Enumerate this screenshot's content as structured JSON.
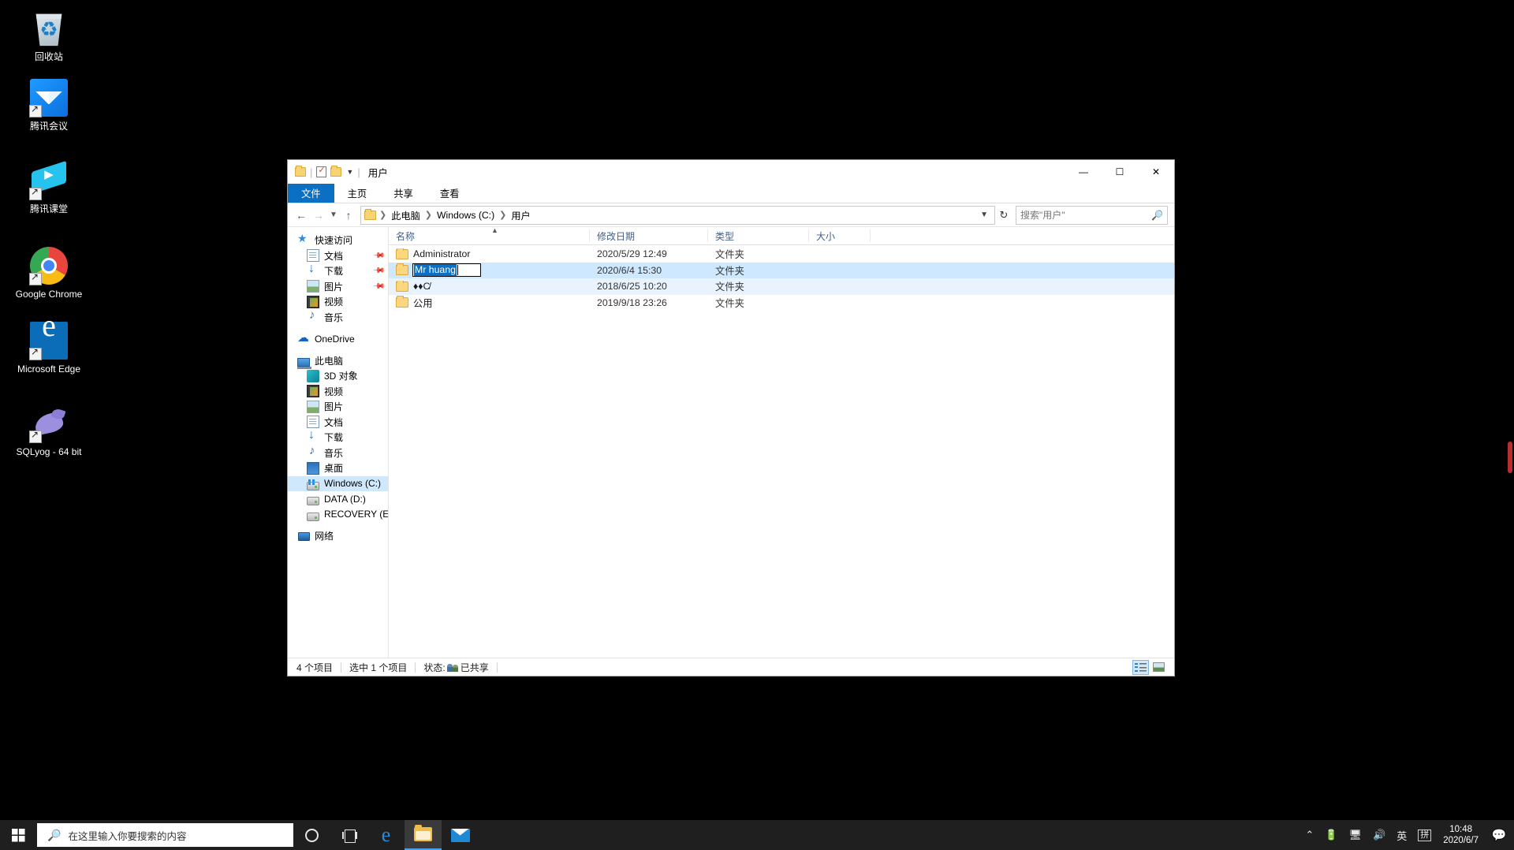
{
  "desktop": {
    "icons": [
      {
        "label": "回收站",
        "icon": "recycle-bin-icon",
        "shortcut": false
      },
      {
        "label": "腾讯会议",
        "icon": "tencent-meeting-icon",
        "shortcut": true
      },
      {
        "label": "腾讯课堂",
        "icon": "tencent-classroom-icon",
        "shortcut": true
      },
      {
        "label": "Google Chrome",
        "icon": "chrome-icon",
        "shortcut": true
      },
      {
        "label": "Microsoft Edge",
        "icon": "edge-icon",
        "shortcut": true
      },
      {
        "label": "SQLyog - 64 bit",
        "icon": "sqlyog-icon",
        "shortcut": true
      }
    ]
  },
  "explorer": {
    "title": "用户",
    "quick_access_toolbar": {
      "folder_icon": "folder-icon",
      "properties_icon": "properties-icon",
      "new_folder_icon": "new-folder-icon",
      "dropdown_icon": "chevron-down-icon"
    },
    "window_controls": {
      "minimize": "—",
      "maximize": "☐",
      "close": "✕"
    },
    "ribbon_tabs": [
      {
        "label": "文件",
        "active": true
      },
      {
        "label": "主页",
        "active": false
      },
      {
        "label": "共享",
        "active": false
      },
      {
        "label": "查看",
        "active": false
      }
    ],
    "ribbon_collapse_icon": "chevron-up-icon",
    "help_icon": "help-icon",
    "navigation": {
      "back_icon": "arrow-left-icon",
      "forward_icon": "arrow-right-icon",
      "recent_icon": "chevron-down-icon",
      "up_icon": "arrow-up-icon",
      "refresh_icon": "refresh-icon",
      "address_dropdown_icon": "chevron-down-icon"
    },
    "breadcrumbs": [
      "此电脑",
      "Windows (C:)",
      "用户"
    ],
    "search": {
      "placeholder": "搜索\"用户\"",
      "icon": "search-icon"
    },
    "nav_pane": {
      "items": [
        {
          "label": "快速访问",
          "icon": "star-icon",
          "indent": 0,
          "pinned": false,
          "selected": false
        },
        {
          "label": "文档",
          "icon": "documents-icon",
          "indent": 1,
          "pinned": true,
          "selected": false
        },
        {
          "label": "下载",
          "icon": "downloads-icon",
          "indent": 1,
          "pinned": true,
          "selected": false
        },
        {
          "label": "图片",
          "icon": "pictures-icon",
          "indent": 1,
          "pinned": true,
          "selected": false
        },
        {
          "label": "视频",
          "icon": "videos-icon",
          "indent": 1,
          "pinned": false,
          "selected": false
        },
        {
          "label": "音乐",
          "icon": "music-icon",
          "indent": 1,
          "pinned": false,
          "selected": false
        },
        {
          "label": "OneDrive",
          "icon": "onedrive-icon",
          "indent": 0,
          "pinned": false,
          "selected": false,
          "gap_before": true
        },
        {
          "label": "此电脑",
          "icon": "this-pc-icon",
          "indent": 0,
          "pinned": false,
          "selected": false,
          "gap_before": true
        },
        {
          "label": "3D 对象",
          "icon": "3d-objects-icon",
          "indent": 1,
          "pinned": false,
          "selected": false
        },
        {
          "label": "视频",
          "icon": "videos-icon",
          "indent": 1,
          "pinned": false,
          "selected": false
        },
        {
          "label": "图片",
          "icon": "pictures-icon",
          "indent": 1,
          "pinned": false,
          "selected": false
        },
        {
          "label": "文档",
          "icon": "documents-icon",
          "indent": 1,
          "pinned": false,
          "selected": false
        },
        {
          "label": "下载",
          "icon": "downloads-icon",
          "indent": 1,
          "pinned": false,
          "selected": false
        },
        {
          "label": "音乐",
          "icon": "music-icon",
          "indent": 1,
          "pinned": false,
          "selected": false
        },
        {
          "label": "桌面",
          "icon": "desktop-icon",
          "indent": 1,
          "pinned": false,
          "selected": false
        },
        {
          "label": "Windows (C:)",
          "icon": "windows-drive-icon",
          "indent": 1,
          "pinned": false,
          "selected": true
        },
        {
          "label": "DATA (D:)",
          "icon": "hdd-icon",
          "indent": 1,
          "pinned": false,
          "selected": false
        },
        {
          "label": "RECOVERY (E:)",
          "icon": "hdd-icon",
          "indent": 1,
          "pinned": false,
          "selected": false
        },
        {
          "label": "网络",
          "icon": "network-icon",
          "indent": 0,
          "pinned": false,
          "selected": false,
          "gap_before": true
        }
      ]
    },
    "columns": [
      {
        "key": "name",
        "label": "名称",
        "sorted": true,
        "sort_dir": "asc"
      },
      {
        "key": "date",
        "label": "修改日期",
        "sorted": false
      },
      {
        "key": "type",
        "label": "类型",
        "sorted": false
      },
      {
        "key": "size",
        "label": "大小",
        "sorted": false
      }
    ],
    "files": [
      {
        "name": "Administrator",
        "date": "2020/5/29 12:49",
        "type": "文件夹",
        "size": "",
        "state": "normal",
        "editing": false
      },
      {
        "name": "Mr huang",
        "date": "2020/6/4 15:30",
        "type": "文件夹",
        "size": "",
        "state": "selected",
        "editing": true
      },
      {
        "name": "♦♦C̸",
        "date": "2018/6/25 10:20",
        "type": "文件夹",
        "size": "",
        "state": "highlight",
        "editing": false
      },
      {
        "name": "公用",
        "date": "2019/9/18 23:26",
        "type": "文件夹",
        "size": "",
        "state": "normal",
        "editing": false
      }
    ],
    "status_bar": {
      "item_count": "4 个项目",
      "selected_count": "选中 1 个项目",
      "state_label": "状态:",
      "state_value": "已共享",
      "share_icon": "shared-users-icon",
      "view_buttons": [
        {
          "name": "details-view-button",
          "active": true
        },
        {
          "name": "large-icons-view-button",
          "active": false
        }
      ]
    }
  },
  "taskbar": {
    "start_icon": "windows-start-icon",
    "search": {
      "placeholder": "在这里输入你要搜索的内容",
      "icon": "search-icon"
    },
    "buttons": [
      {
        "name": "cortana-button",
        "icon": "cortana-icon",
        "active": false
      },
      {
        "name": "task-view-button",
        "icon": "task-view-icon",
        "active": false
      },
      {
        "name": "edge-taskbar-button",
        "icon": "edge-icon",
        "active": false
      },
      {
        "name": "file-explorer-taskbar-button",
        "icon": "folder-icon",
        "active": true
      },
      {
        "name": "mail-taskbar-button",
        "icon": "mail-icon",
        "active": false
      }
    ],
    "tray": [
      {
        "name": "show-hidden-icons",
        "glyph": "⌃"
      },
      {
        "name": "battery-icon",
        "glyph": "🔋"
      },
      {
        "name": "network-icon",
        "glyph": "🖥"
      },
      {
        "name": "volume-icon",
        "glyph": "🔊"
      },
      {
        "name": "ime-language-icon",
        "glyph": "英"
      },
      {
        "name": "ime-pinyin-icon",
        "glyph": "拼"
      }
    ],
    "clock": {
      "time": "10:48",
      "date": "2020/6/7"
    },
    "notification_icon": "action-center-icon"
  },
  "colors": {
    "accent": "#0b6fc4",
    "selection": "#cde8ff",
    "highlight": "#e8f3fd",
    "taskbar": "#1f1f1f",
    "folder": "#fcd77f"
  }
}
